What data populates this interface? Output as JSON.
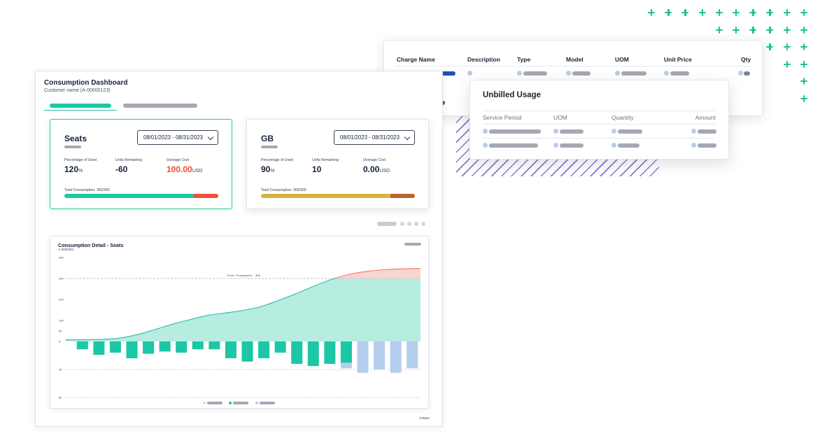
{
  "charges_table": {
    "headers": [
      "Charge Name",
      "Description",
      "Type",
      "Model",
      "UOM",
      "Unit Price",
      "Qty"
    ]
  },
  "unbilled": {
    "title": "Unbilled Usage",
    "headers": [
      "Service Period",
      "UOM",
      "Quantity",
      "Amount"
    ]
  },
  "dashboard": {
    "title": "Consumption Dashboard",
    "customer": "Customer name (A-00000123)",
    "footer_note": "3:06am"
  },
  "metric_cards": [
    {
      "name": "Seats",
      "date_range": "08/01/2023 - 08/31/2023",
      "pct_label": "Percentage of Used",
      "pct_value": "120",
      "pct_unit": "%",
      "rem_label": "Units Remaining",
      "rem_value": "-60",
      "over_label": "Overage Cost",
      "over_value": "100.00",
      "over_unit": "USD",
      "total_label": "Total Consumption: 360/300",
      "usage_bar": {
        "primary_fraction": 0.84,
        "primary_color": "#1cc7a5",
        "overflow_color": "#f0503c"
      }
    },
    {
      "name": "GB",
      "date_range": "08/01/2023 - 08/31/2023",
      "pct_label": "Percentage of Used",
      "pct_value": "90",
      "pct_unit": "%",
      "rem_label": "Units Remaining",
      "rem_value": "10",
      "over_label": "Overage Cost",
      "over_value": "0.00",
      "over_unit": "USD",
      "total_label": "Total Consumption: 360/300",
      "usage_bar": {
        "primary_fraction": 0.84,
        "primary_color": "#dcb23f",
        "overflow_color": "#b8642c"
      }
    }
  ],
  "detail": {
    "title": "Consumption Detail - Seats",
    "subtitle": "A-0000001",
    "prepayment_label": "Total Prepayment: 300"
  },
  "chart_data": {
    "type": "area",
    "y_ticks": [
      "400",
      "300",
      "200",
      "100",
      "50",
      "0",
      "25",
      "50"
    ],
    "prepayment": 300,
    "ylim": [
      0,
      400
    ],
    "cumulative": {
      "x": [
        0,
        0.05,
        0.1,
        0.15,
        0.2,
        0.25,
        0.3,
        0.35,
        0.4,
        0.45,
        0.5,
        0.55,
        0.6,
        0.65,
        0.7,
        0.75,
        0.8,
        0.85,
        0.9,
        0.95,
        1
      ],
      "values": [
        8,
        8,
        10,
        16,
        32,
        56,
        82,
        104,
        124,
        136,
        148,
        166,
        196,
        228,
        264,
        296,
        320,
        334,
        342,
        346,
        348
      ],
      "fill_color": "#b6ede0",
      "line_color": "#1ab79a",
      "overage_fill": "#fbd3cf",
      "overage_line": "#ea5a4a"
    },
    "daily_bars": {
      "values": [
        -7,
        -12,
        -10,
        -15,
        -11,
        -9,
        -10,
        -7,
        -7,
        -15,
        -18,
        -15,
        -10,
        -20,
        -22,
        -20,
        -24,
        -28,
        -25,
        -28,
        -24
      ],
      "actual_color": "#1cc7a5",
      "forecast_color": "#b5cdef",
      "forecast_from_index": 17,
      "split_bar_index": 16,
      "split_bar_forecast_part": -5
    },
    "legend": [
      {
        "color": "#bfe7df"
      },
      {
        "color": "#1cc7a5"
      },
      {
        "color": "#b5cdef"
      }
    ]
  }
}
